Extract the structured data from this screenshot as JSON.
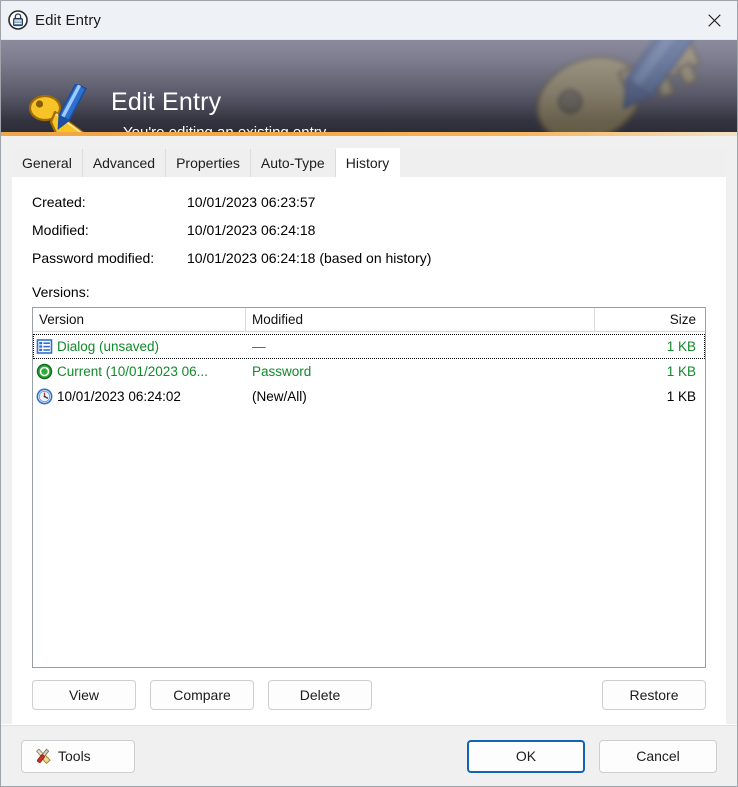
{
  "window": {
    "title": "Edit Entry",
    "icon": "keepass-lock-icon",
    "close_label": "✕"
  },
  "banner": {
    "heading": "Edit Entry",
    "subtitle": "You're editing an existing entry.",
    "icon": "key-pencil-icon",
    "accent_color": "#f5a93f",
    "gradient_top": "#8b8b9d",
    "gradient_bottom": "#2b2b36"
  },
  "tabs": [
    {
      "label": "General",
      "active": false
    },
    {
      "label": "Advanced",
      "active": false
    },
    {
      "label": "Properties",
      "active": false
    },
    {
      "label": "Auto-Type",
      "active": false
    },
    {
      "label": "History",
      "active": true
    }
  ],
  "history": {
    "info": [
      {
        "label": "Created:",
        "value": "10/01/2023 06:23:57"
      },
      {
        "label": "Modified:",
        "value": "10/01/2023 06:24:18"
      },
      {
        "label": "Password modified:",
        "value": "10/01/2023 06:24:18 (based on history)"
      }
    ],
    "versions_label": "Versions:",
    "columns": [
      "Version",
      "Modified",
      "Size"
    ],
    "rows": [
      {
        "icon": "list-form-icon",
        "version": "Dialog (unsaved)",
        "modified": "—",
        "size": "1 KB",
        "color": "#118a2a",
        "focused": true
      },
      {
        "icon": "green-circle-icon",
        "version": "Current (10/01/2023 06...",
        "modified": "Password",
        "size": "1 KB",
        "color": "#118a2a",
        "focused": false
      },
      {
        "icon": "clock-icon",
        "version": "10/01/2023 06:24:02",
        "modified": "(New/All)",
        "size": "1 KB",
        "color": "#000000",
        "focused": false
      }
    ],
    "actions": {
      "view": "View",
      "compare": "Compare",
      "delete": "Delete",
      "restore": "Restore"
    }
  },
  "footer": {
    "tools": "Tools",
    "tools_icon": "tools-icon",
    "ok": "OK",
    "cancel": "Cancel",
    "default_button_color": "#1263b4"
  }
}
